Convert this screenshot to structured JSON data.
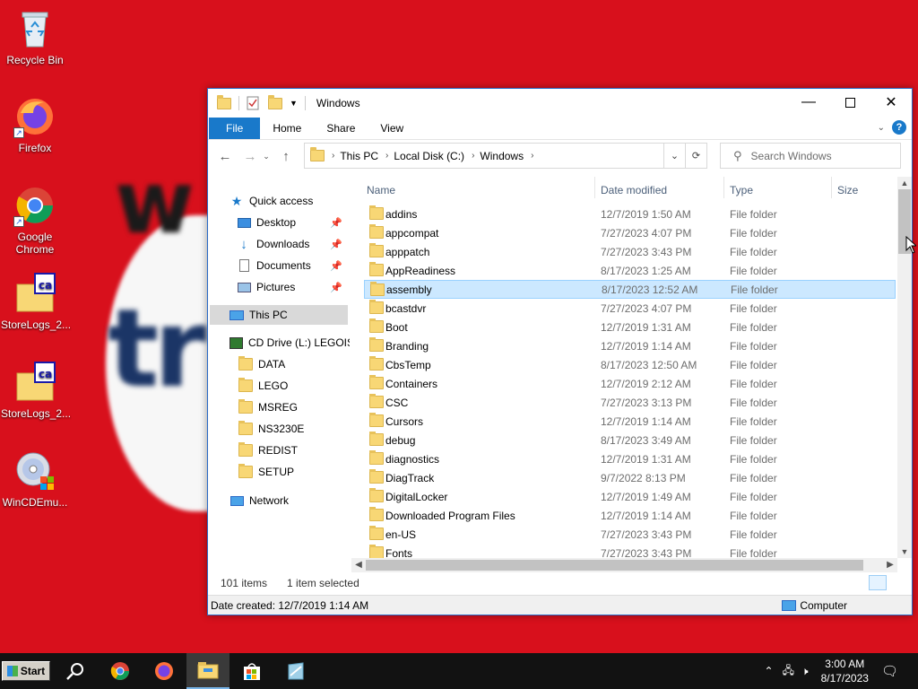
{
  "desktop": {
    "icons": [
      {
        "label": "Recycle Bin"
      },
      {
        "label": "Firefox"
      },
      {
        "label": "Google Chrome"
      },
      {
        "label": "StoreLogs_2..."
      },
      {
        "label": "StoreLogs_2..."
      },
      {
        "label": "WinCDEmu..."
      }
    ]
  },
  "window": {
    "title": "Windows",
    "ribbon_tabs": [
      "File",
      "Home",
      "Share",
      "View"
    ],
    "breadcrumb": [
      "This PC",
      "Local Disk (C:)",
      "Windows"
    ],
    "search_placeholder": "Search Windows"
  },
  "navpane": {
    "quick_access": "Quick access",
    "pinned": [
      "Desktop",
      "Downloads",
      "Documents",
      "Pictures"
    ],
    "this_pc": "This PC",
    "cd_drive": "CD Drive (L:) LEGOISL",
    "cd_folders": [
      "DATA",
      "LEGO",
      "MSREG",
      "NS3230E",
      "REDIST",
      "SETUP"
    ],
    "network": "Network"
  },
  "columns": {
    "name": "Name",
    "date": "Date modified",
    "type": "Type",
    "size": "Size"
  },
  "files": [
    {
      "name": "addins",
      "date": "12/7/2019 1:50 AM",
      "type": "File folder"
    },
    {
      "name": "appcompat",
      "date": "7/27/2023 4:07 PM",
      "type": "File folder"
    },
    {
      "name": "apppatch",
      "date": "7/27/2023 3:43 PM",
      "type": "File folder"
    },
    {
      "name": "AppReadiness",
      "date": "8/17/2023 1:25 AM",
      "type": "File folder"
    },
    {
      "name": "assembly",
      "date": "8/17/2023 12:52 AM",
      "type": "File folder",
      "selected": true
    },
    {
      "name": "bcastdvr",
      "date": "7/27/2023 4:07 PM",
      "type": "File folder"
    },
    {
      "name": "Boot",
      "date": "12/7/2019 1:31 AM",
      "type": "File folder"
    },
    {
      "name": "Branding",
      "date": "12/7/2019 1:14 AM",
      "type": "File folder"
    },
    {
      "name": "CbsTemp",
      "date": "8/17/2023 12:50 AM",
      "type": "File folder"
    },
    {
      "name": "Containers",
      "date": "12/7/2019 2:12 AM",
      "type": "File folder"
    },
    {
      "name": "CSC",
      "date": "7/27/2023 3:13 PM",
      "type": "File folder"
    },
    {
      "name": "Cursors",
      "date": "12/7/2019 1:14 AM",
      "type": "File folder"
    },
    {
      "name": "debug",
      "date": "8/17/2023 3:49 AM",
      "type": "File folder"
    },
    {
      "name": "diagnostics",
      "date": "12/7/2019 1:31 AM",
      "type": "File folder"
    },
    {
      "name": "DiagTrack",
      "date": "9/7/2022 8:13 PM",
      "type": "File folder"
    },
    {
      "name": "DigitalLocker",
      "date": "12/7/2019 1:49 AM",
      "type": "File folder"
    },
    {
      "name": "Downloaded Program Files",
      "date": "12/7/2019 1:14 AM",
      "type": "File folder"
    },
    {
      "name": "en-US",
      "date": "7/27/2023 3:43 PM",
      "type": "File folder"
    },
    {
      "name": "Fonts",
      "date": "7/27/2023 3:43 PM",
      "type": "File folder"
    }
  ],
  "status": {
    "item_count": "101 items",
    "selected": "1 item selected",
    "date_created": "Date created: 12/7/2019 1:14 AM",
    "computer": "Computer"
  },
  "taskbar": {
    "start_label": "Start",
    "time": "3:00 AM",
    "date": "8/17/2023"
  },
  "colors": {
    "desktop_bg": "#d8101c",
    "accent": "#1979ca",
    "selection": "#cce8ff"
  }
}
